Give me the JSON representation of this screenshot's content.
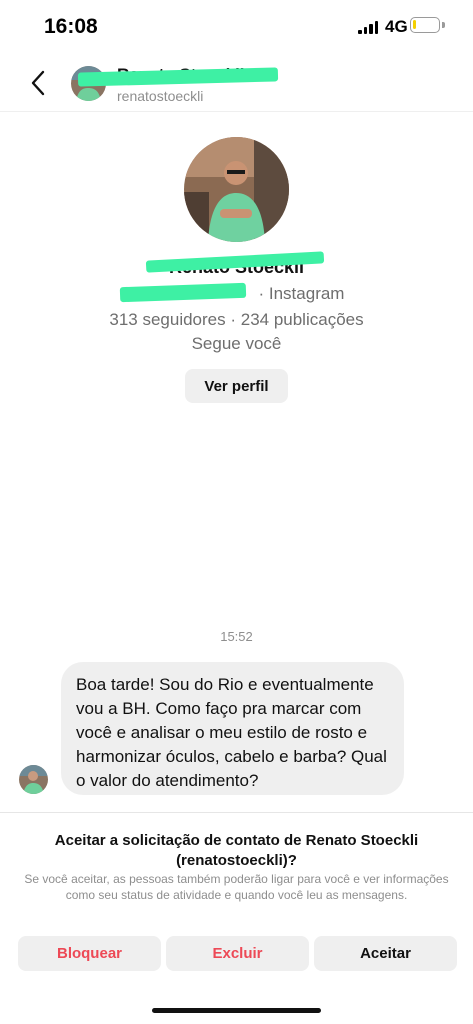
{
  "status_bar": {
    "time": "16:08",
    "network": "4G",
    "battery_level": 0.15,
    "battery_color": "#f4d000"
  },
  "header": {
    "name": "Renato Stoeckli",
    "username": "renatostoeckli",
    "back_icon": "chevron-left-icon"
  },
  "profile": {
    "name": "Renato Stoeckli",
    "platform": "· Instagram",
    "stats": "313 seguidores · 234 publicações",
    "follows_you": "Segue você",
    "view_profile_label": "Ver perfil"
  },
  "conversation": {
    "timestamp": "15:52",
    "message": "Boa tarde! Sou do Rio e eventualmente vou a BH. Como faço pra marcar com você e analisar o meu estilo de rosto e harmonizar óculos, cabelo e barba? Qual o valor do atendimento?"
  },
  "request": {
    "title": "Aceitar a solicitação de contato de Renato Stoeckli (renatostoeckli)?",
    "description": "Se você aceitar, as pessoas também poderão ligar para você e ver informações como seu status de atividade e quando você leu as mensagens.",
    "block_label": "Bloquear",
    "delete_label": "Excluir",
    "accept_label": "Aceitar"
  },
  "colors": {
    "destructive": "#ed4956",
    "redaction": "#3ef0a4",
    "button_bg": "#efefef"
  }
}
